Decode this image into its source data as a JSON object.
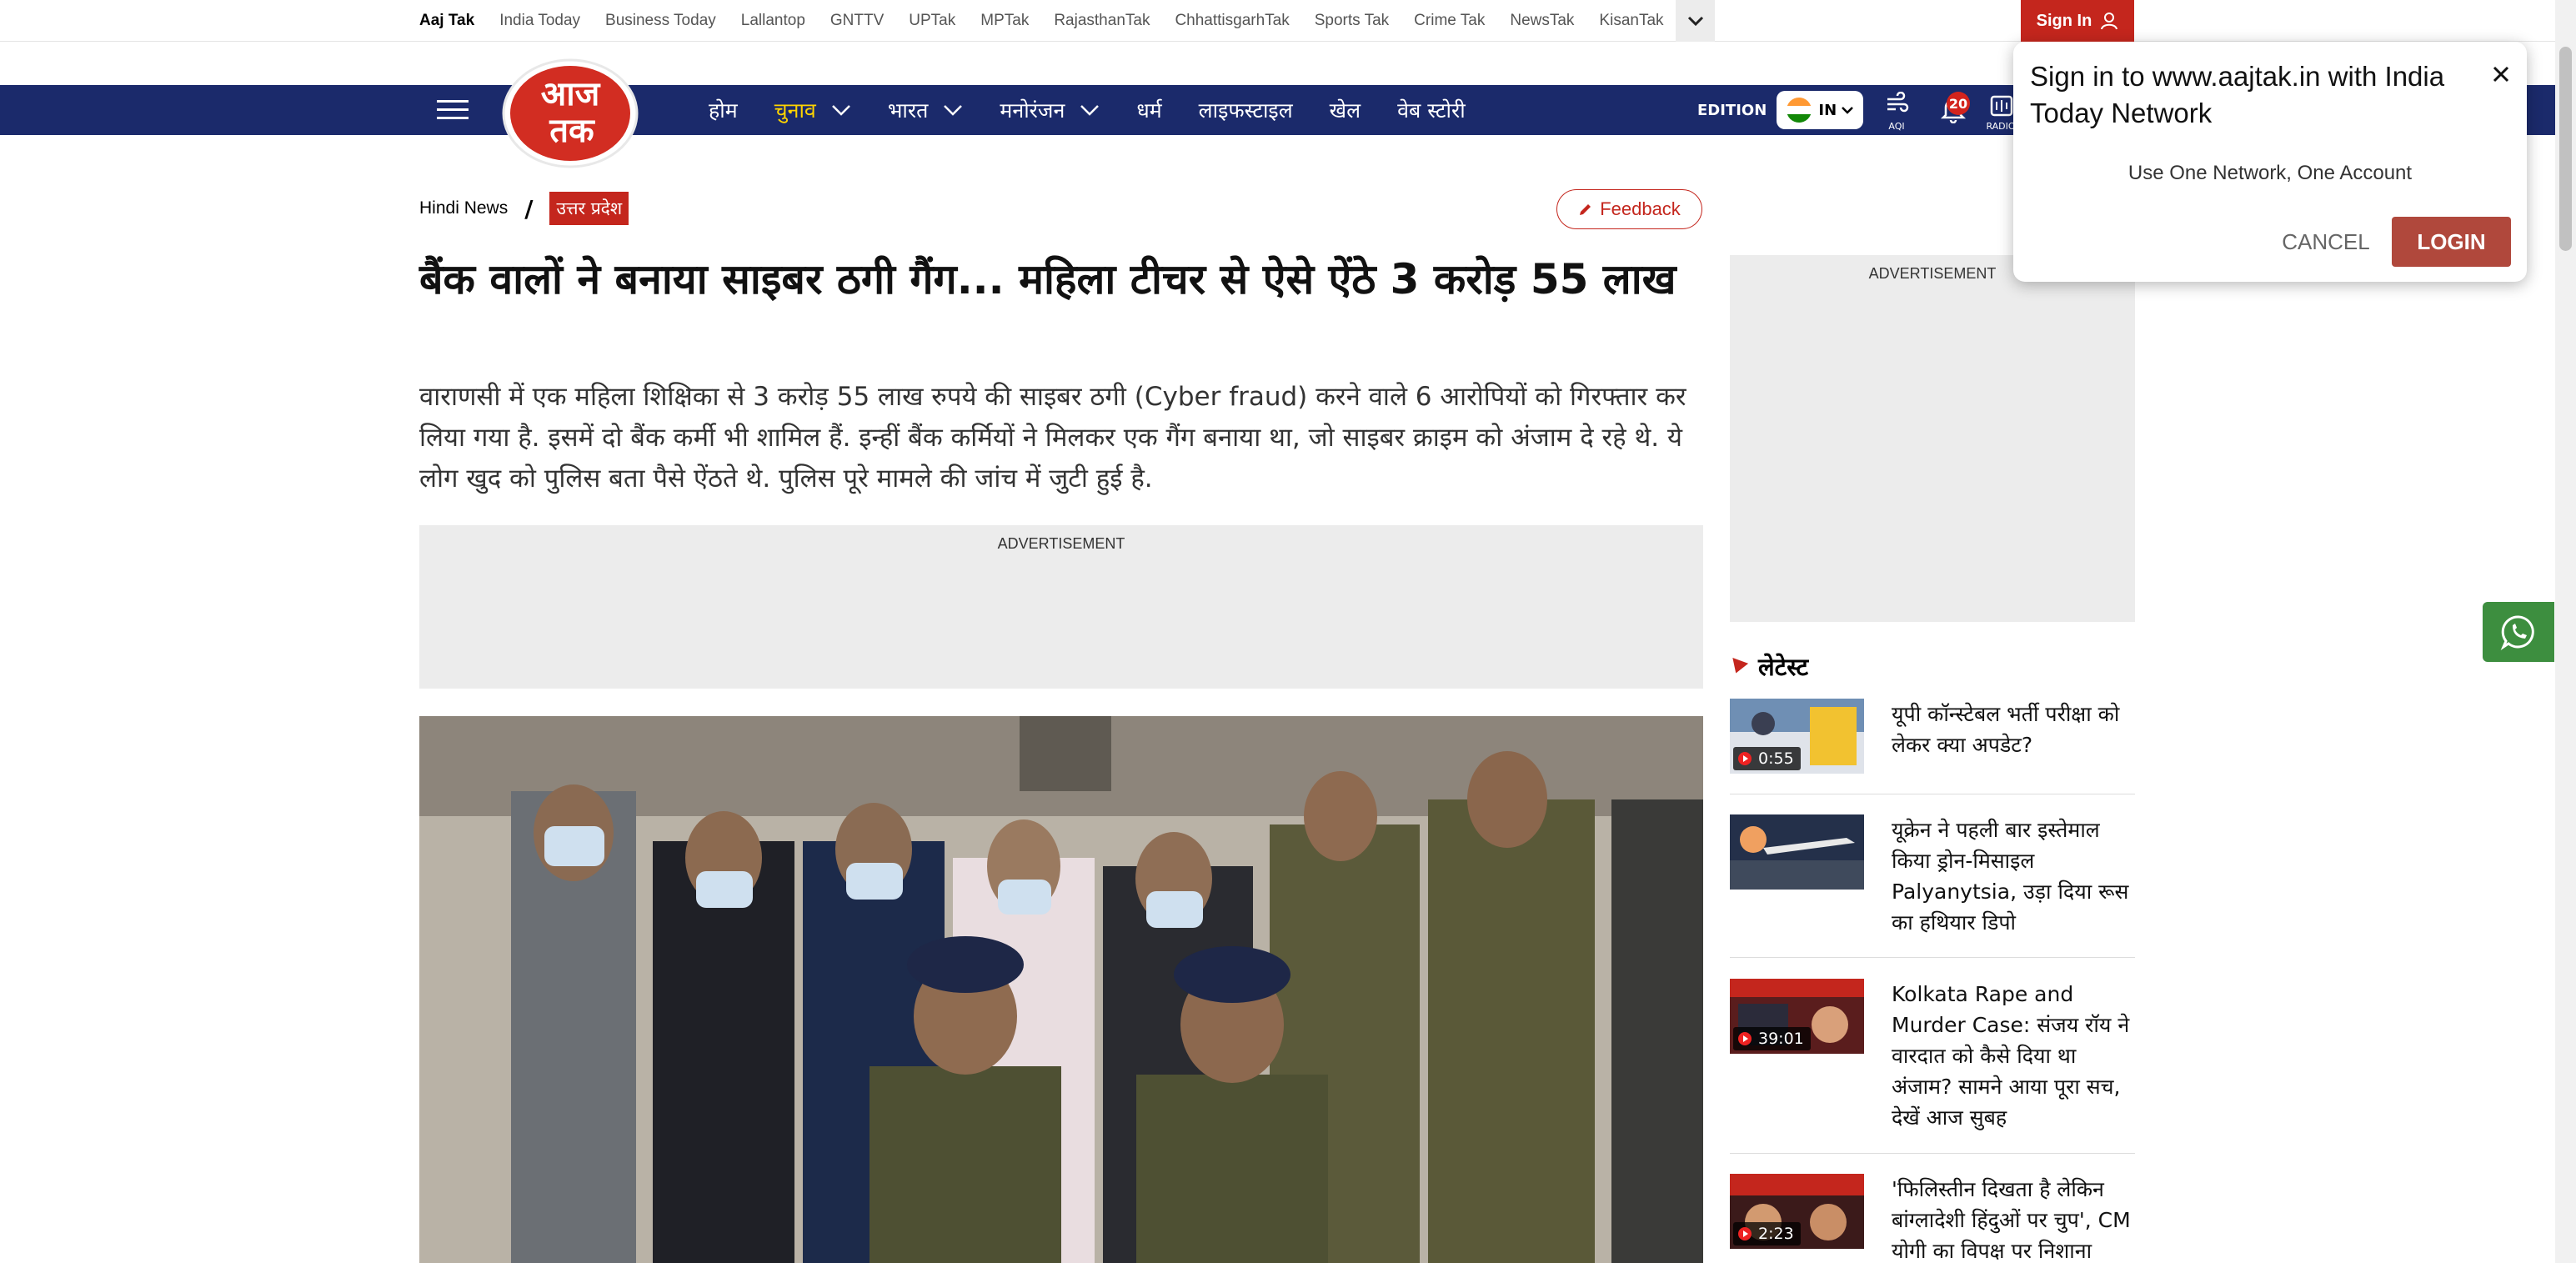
{
  "network_bar": {
    "links": [
      "Aaj Tak",
      "India Today",
      "Business Today",
      "Lallantop",
      "GNTTV",
      "UPTak",
      "MPTak",
      "RajasthanTak",
      "ChhattisgarhTak",
      "Sports Tak",
      "Crime Tak",
      "NewsTak",
      "KisanTak"
    ],
    "more_icon": "chevron-down-icon",
    "signin_label": "Sign In",
    "signin_icon": "user-icon"
  },
  "logo_text": "आज तक",
  "nav": {
    "items": [
      {
        "label": "होम",
        "dropdown": false
      },
      {
        "label": "चुनाव",
        "dropdown": true,
        "selected": true
      },
      {
        "label": "भारत",
        "dropdown": true
      },
      {
        "label": "मनोरंजन",
        "dropdown": true
      },
      {
        "label": "धर्म",
        "dropdown": false
      },
      {
        "label": "लाइफस्टाइल",
        "dropdown": false
      },
      {
        "label": "खेल",
        "dropdown": false
      },
      {
        "label": "वेब स्टोरी",
        "dropdown": false
      }
    ],
    "edition_label": "EDITION",
    "edition_value": "IN",
    "aqi_label": "AQI",
    "notification_count": "20",
    "radio_label": "RADIO"
  },
  "breadcrumb": {
    "home": "Hindi News",
    "separator": "/",
    "category": "उत्तर प्रदेश"
  },
  "feedback_label": "Feedback",
  "article": {
    "headline": "बैंक वालों ने बनाया साइबर ठगी गैंग... महिला टीचर से ऐसे ऐंठे 3 करोड़ 55 लाख",
    "summary": "वाराणसी में एक महिला शिक्षिका से 3 करोड़ 55 लाख रुपये की साइबर ठगी (Cyber fraud) करने वाले 6 आरोपियों को गिरफ्तार कर लिया गया है. इसमें दो बैंक कर्मी भी शामिल हैं. इन्हीं बैंक कर्मियों ने मिलकर एक गैंग बनाया था, जो साइबर क्राइम को अंजाम दे रहे थे. ये लोग खुद को पुलिस बता पैसे ऐंठते थे. पुलिस पूरे मामले की जांच में जुटी हुई है."
  },
  "ads": {
    "label": "ADVERTISEMENT"
  },
  "latest": {
    "title": "लेटेस्ट",
    "items": [
      {
        "title": "यूपी कॉन्स्टेबल भर्ती परीक्षा को लेकर क्या अपडेट?",
        "duration": "0:55"
      },
      {
        "title": "यूक्रेन ने पहली बार इस्तेमाल किया ड्रोन-मिसाइल Palyanytsia, उड़ा दिया रूस का हथियार डिपो",
        "duration": ""
      },
      {
        "title": "Kolkata Rape and Murder Case: संजय रॉय ने वारदात को कैसे दिया था अंजाम? सामने आया पूरा सच, देखें आज सुबह",
        "duration": "39:01"
      },
      {
        "title": "'फिलिस्तीन दिखता है लेकिन बांग्लादेशी हिंदुओं पर चुप', CM योगी का विपक्ष पर निशाना",
        "duration": "2:23"
      }
    ]
  },
  "popup": {
    "title": "Sign in to www.aajtak.in with India Today Network",
    "subtitle": "Use One Network, One Account",
    "cancel_label": "CANCEL",
    "login_label": "LOGIN"
  },
  "colors": {
    "brand_red": "#c4261d",
    "nav_blue": "#1b2a6b",
    "nav_selected": "#ffd400",
    "whatsapp_green": "#3d8e3f",
    "login_button": "#b0483c"
  }
}
